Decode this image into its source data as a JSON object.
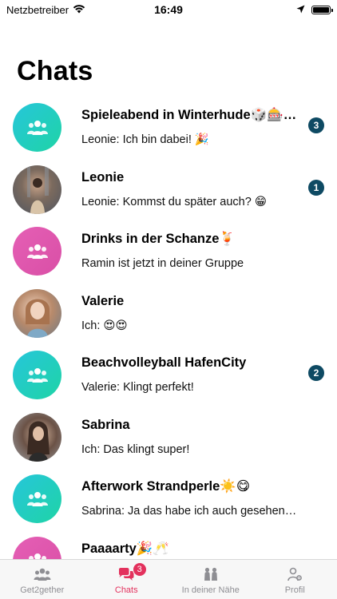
{
  "status_bar": {
    "carrier": "Netzbetreiber",
    "time": "16:49",
    "battery_level": 1.0
  },
  "page": {
    "title": "Chats"
  },
  "chats": [
    {
      "name": "Spieleabend in Winterhude🎲🎰…",
      "preview": "Leonie: Ich bin dabei! 🎉",
      "avatar": "group-icon",
      "avatar_color": "#1fcfb5",
      "unread": "3"
    },
    {
      "name": "Leonie",
      "preview": "Leonie: Kommst du später auch? 😁",
      "avatar": "photo",
      "unread": "1"
    },
    {
      "name": "Drinks in der Schanze🍹",
      "preview": "Ramin ist jetzt in deiner Gruppe",
      "avatar": "group-icon",
      "avatar_color": "#dd55ad",
      "unread": ""
    },
    {
      "name": "Valerie",
      "preview": "Ich: 😍😍",
      "avatar": "photo",
      "unread": ""
    },
    {
      "name": "Beachvolleyball HafenCity",
      "preview": "Valerie: Klingt perfekt!",
      "avatar": "group-icon",
      "avatar_color": "#1fcfb5",
      "unread": "2"
    },
    {
      "name": "Sabrina",
      "preview": "Ich: Das klingt super!",
      "avatar": "photo",
      "unread": ""
    },
    {
      "name": "Afterwork Strandperle☀️😋",
      "preview": "Sabrina: Ja das habe ich auch gesehen…",
      "avatar": "group-icon",
      "avatar_color": "#1fcfb5",
      "unread": ""
    },
    {
      "name": "Paaaarty🎉🥂",
      "preview": "",
      "avatar": "group-icon",
      "avatar_color": "#dd55ad",
      "unread": ""
    }
  ],
  "tab_bar": {
    "tabs": [
      {
        "label": "Get2gether",
        "icon": "group-icon",
        "active": false
      },
      {
        "label": "Chats",
        "icon": "chat-bubbles-icon",
        "active": true,
        "badge": "3"
      },
      {
        "label": "In deiner Nähe",
        "icon": "nearby-people-icon",
        "active": false
      },
      {
        "label": "Profil",
        "icon": "profile-settings-icon",
        "active": false
      }
    ]
  },
  "colors": {
    "accent": "#e3315d",
    "unread_badge": "#0e4a63",
    "group_teal": "#1fcfb5",
    "group_pink": "#dd55ad",
    "tab_inactive": "#8e8e93"
  }
}
